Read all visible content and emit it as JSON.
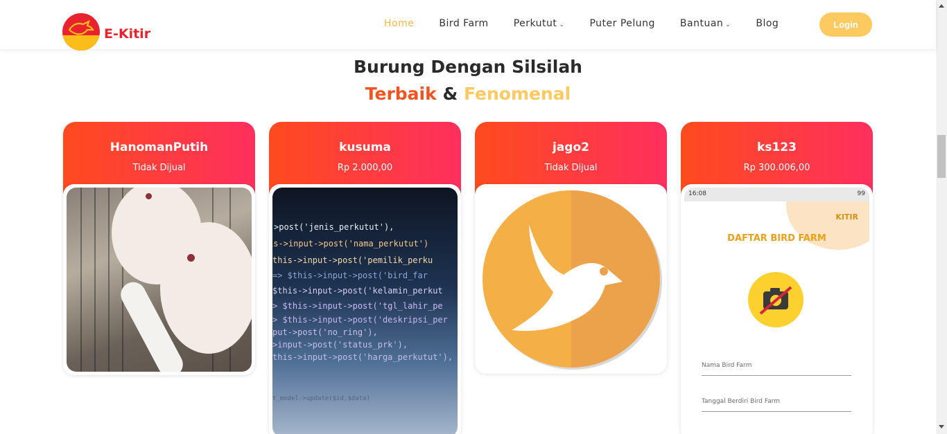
{
  "brand": {
    "name": "E-Kitir"
  },
  "nav": {
    "items": [
      {
        "label": "Home",
        "active": true,
        "dropdown": false
      },
      {
        "label": "Bird Farm",
        "active": false,
        "dropdown": false
      },
      {
        "label": "Perkutut",
        "active": false,
        "dropdown": true
      },
      {
        "label": "Puter Pelung",
        "active": false,
        "dropdown": false
      },
      {
        "label": "Bantuan",
        "active": false,
        "dropdown": true
      },
      {
        "label": "Blog",
        "active": false,
        "dropdown": false
      }
    ],
    "login_label": "Login"
  },
  "section": {
    "title_line1": "Burung Dengan Silsilah",
    "title_word_red": "Terbaik",
    "title_amp": "&",
    "title_word_yellow": "Fenomenal"
  },
  "cards": [
    {
      "name": "HanomanPutih",
      "price": "Tidak Dijual",
      "image": "white-doves-photo"
    },
    {
      "name": "kusuma",
      "price": "Rp 2.000,00",
      "image": "code-screen-photo"
    },
    {
      "name": "jago2",
      "price": "Tidak Dijual",
      "image": "bird-logo"
    },
    {
      "name": "ks123",
      "price": "Rp 300.006,00",
      "image": "app-screenshot"
    }
  ],
  "code_lines": [
    ">post('jenis_perkutut'),",
    "is->input->post('nama_perkutut')",
    "this->input->post('pemilik_perku",
    "=> $this->input->post('bird_far",
    "$this->input->post('kelamin_perkut",
    "> $this->input->post('tgl_lahir_pe",
    "> $this->input->post('deskripsi_per",
    "put->post('no_ring'),",
    ">input->post('status_prk'),",
    "this->input->post('harga_perkutut'),",
    "t_model->update($id,$data)"
  ],
  "phone": {
    "status_time": "16:08",
    "status_battery": "99",
    "logo_text": "KITIR",
    "title": "DAFTAR BIRD FARM",
    "field1": "Nama Bird Farm",
    "field2": "Tanggal Berdiri Bird Farm"
  },
  "colors": {
    "accent_yellow": "#fdc961",
    "accent_red": "#f25320",
    "card_gradient_start": "#fe4b1e",
    "card_gradient_end": "#fe2f5e",
    "brand_red": "#e8232e"
  }
}
